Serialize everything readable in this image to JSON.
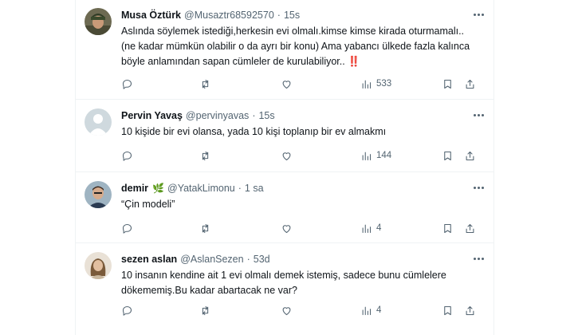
{
  "tweets": [
    {
      "name": "Musa Öztürk",
      "handle": "@Musaztr68592570",
      "time": "15s",
      "text": "Aslında söylemek istediği,herkesin evi olmalı.kimse kimse kirada oturmamalı..(ne kadar mümkün olabilir o da ayrı bir konu) Ama yabancı ülkede fazla kalınca böyle anlamından sapan cümleler de kurulabiliyor..",
      "emoji": "‼️",
      "views": "533",
      "avatar": "military-avatar"
    },
    {
      "name": "Pervin Yavaş",
      "handle": "@pervinyavas",
      "time": "15s",
      "text": "10 kişide bir evi olansa, yada 10 kişi toplanıp bir ev almakmı",
      "views": "144",
      "avatar": "default-avatar"
    },
    {
      "name": "demir",
      "name_emoji": "🌿",
      "handle": "@YatakLimonu",
      "time": "1 sa",
      "text": "“Çin modeli”",
      "views": "4",
      "avatar": "man-avatar"
    },
    {
      "name": "sezen aslan",
      "handle": "@AslanSezen",
      "time": "53d",
      "text": "10 insanın kendine ait 1 evi olmalı demek istemiş, sadece bunu cümlelere dökememiş.Bu kadar abartacak ne var?",
      "views": "4",
      "avatar": "woman-avatar"
    }
  ],
  "separator": "·",
  "colors": {
    "text": "#0f1419",
    "muted": "#536471",
    "border": "#eff3f4",
    "emoji_red": "#e0245e"
  }
}
